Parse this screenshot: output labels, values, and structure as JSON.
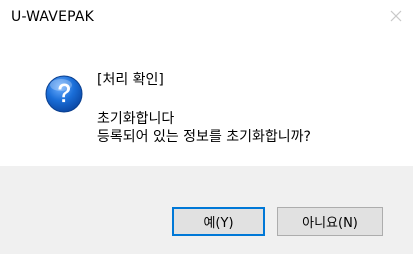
{
  "window": {
    "title": "U-WAVEPAK",
    "close_icon": "close-icon"
  },
  "message": {
    "icon": "question-icon",
    "header": "[처리 확인]",
    "line1": "초기화합니다",
    "line2": "등록되어 있는 정보를 초기화합니까?"
  },
  "buttons": {
    "yes_label": "예(Y)",
    "no_label": "아니요(N)"
  },
  "colors": {
    "icon_blue": "#1a6ed8",
    "focus_border": "#0078d7",
    "footer_bg": "#f0f0f0",
    "button_bg": "#e1e1e1"
  }
}
